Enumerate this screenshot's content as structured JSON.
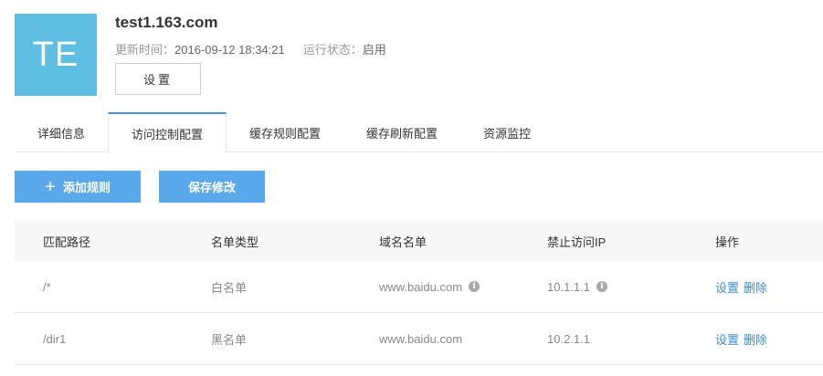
{
  "header": {
    "avatar_text": "TE",
    "domain": "test1.163.com",
    "updated_label": "更新时间：",
    "updated_value": "2016-09-12 18:34:21",
    "status_label": "运行状态：",
    "status_value": "启用",
    "settings_button": "设置"
  },
  "tabs": [
    {
      "label": "详细信息",
      "active": false
    },
    {
      "label": "访问控制配置",
      "active": true
    },
    {
      "label": "缓存规则配置",
      "active": false
    },
    {
      "label": "缓存刷新配置",
      "active": false
    },
    {
      "label": "资源监控",
      "active": false
    }
  ],
  "actions": {
    "add_rule": "添加规则",
    "save_changes": "保存修改"
  },
  "table": {
    "columns": [
      "匹配路径",
      "名单类型",
      "域名名单",
      "禁止访问IP",
      "操作"
    ],
    "rows": [
      {
        "path": "/*",
        "list_type": "白名单",
        "domains": "www.baidu.com",
        "domains_info": true,
        "blocked_ip": "10.1.1.1",
        "ip_info": true,
        "op_set": "设置",
        "op_delete": "删除"
      },
      {
        "path": "/dir1",
        "list_type": "黑名单",
        "domains": "www.baidu.com",
        "domains_info": false,
        "blocked_ip": "10.2.1.1",
        "ip_info": false,
        "op_set": "设置",
        "op_delete": "删除"
      }
    ]
  },
  "colors": {
    "avatar_bg": "#5fbfe2",
    "primary_button": "#5aa8ec",
    "link": "#3c8ad8",
    "active_tab_border": "#4a90e2"
  }
}
